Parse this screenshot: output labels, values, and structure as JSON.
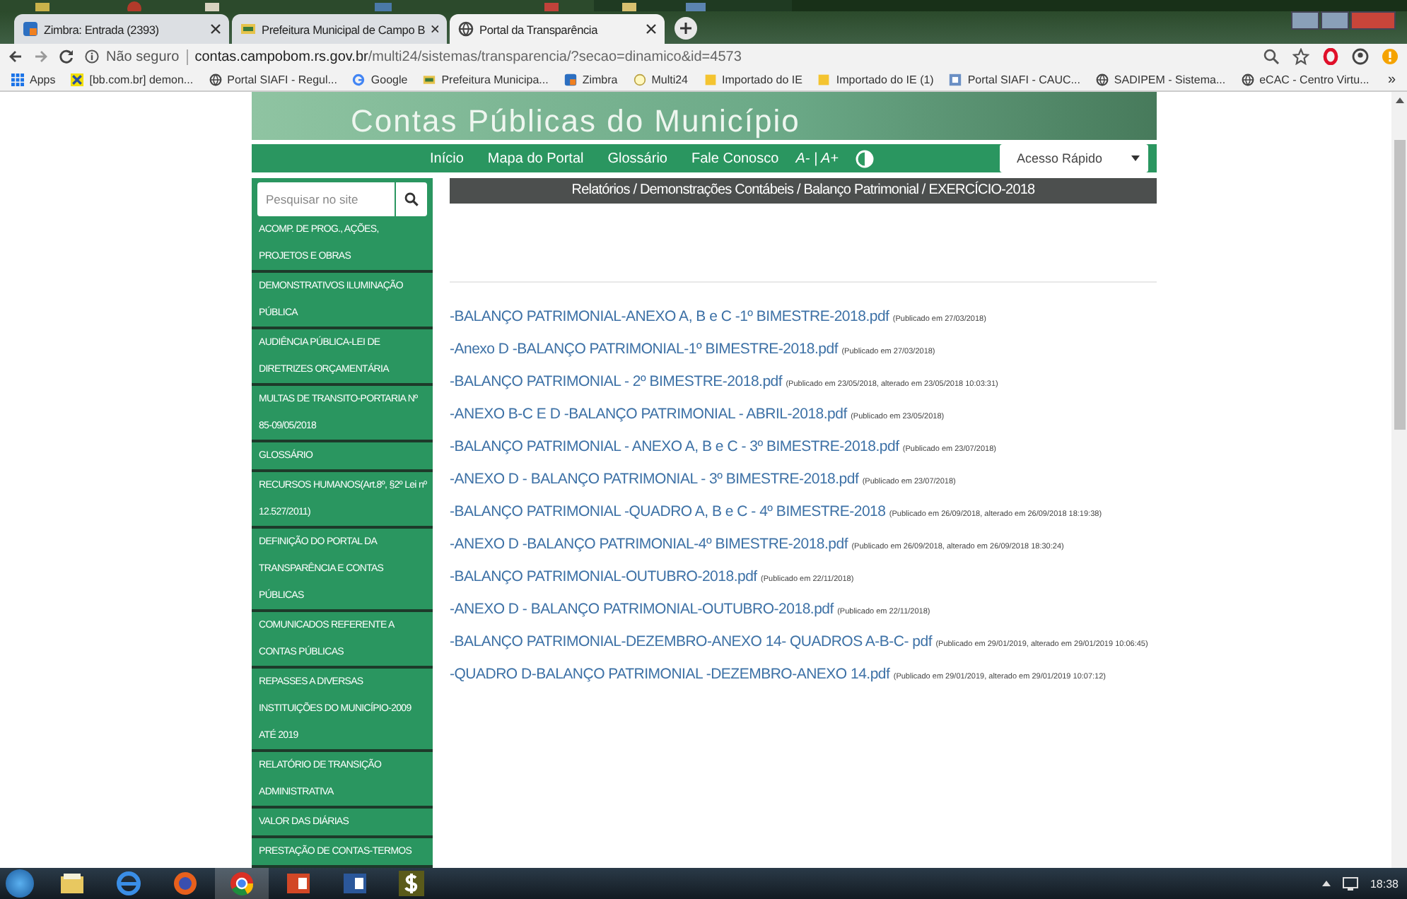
{
  "browser": {
    "tabs": [
      {
        "title": "Zimbra: Entrada (2393)",
        "selected": false
      },
      {
        "title": "Prefeitura Municipal de Campo B",
        "selected": false
      },
      {
        "title": "Portal da Transparência",
        "selected": true
      }
    ],
    "security": "Não seguro",
    "url_host": "contas.campobom.rs.gov.br",
    "url_path": "/multi24/sistemas/transparencia/?secao=dinamico&id=4573",
    "bookmarks": [
      "Apps",
      "[bb.com.br] demon...",
      "Portal SIAFI - Regul...",
      "Google",
      "Prefeitura Municipa...",
      "Zimbra",
      "Multi24",
      "Importado do IE",
      "Importado do IE (1)",
      "Portal SIAFI - CAUC...",
      "SADIPEM - Sistema...",
      "eCAC - Centro Virtu..."
    ],
    "more": "»"
  },
  "site": {
    "banner_title": "Contas Públicas do Município",
    "nav": [
      "Início",
      "Mapa do Portal",
      "Glossário",
      "Fale Conosco"
    ],
    "font_controls": "A- | A+",
    "quick_access": "Acesso Rápido",
    "search_placeholder": "Pesquisar no site",
    "sidebar": [
      "ACOMP. DE PROG., AÇÕES, PROJETOS E OBRAS",
      "DEMONSTRATIVOS ILUMINAÇÃO PÚBLICA",
      "AUDIÊNCIA PÚBLICA-LEI DE DIRETRIZES ORÇAMENTÁRIA",
      "MULTAS DE TRANSITO-PORTARIA Nº 85-09/05/2018",
      "GLOSSÁRIO",
      "RECURSOS HUMANOS(Art.8º, §2º Lei nº 12.527/2011)",
      "DEFINIÇÃO DO PORTAL DA TRANSPARÊNCIA E CONTAS PÚBLICAS",
      "COMUNICADOS REFERENTE A CONTAS PÚBLICAS",
      "REPASSES A DIVERSAS INSTITUIÇÕES DO MUNICÍPIO-2009 ATÉ 2019",
      "RELATÓRIO DE TRANSIÇÃO ADMINISTRATIVA",
      "VALOR DAS DIÁRIAS",
      "PRESTAÇÃO DE CONTAS-TERMOS"
    ],
    "breadcrumb": "Relatórios / Demonstrações Contábeis / Balanço Patrimonial / EXERCÍCIO-2018",
    "documents": [
      {
        "title": "-BALANÇO PATRIMONIAL-ANEXO A, B e C -1º BIMESTRE-2018.pdf",
        "note": "(Publicado em 27/03/2018)"
      },
      {
        "title": "-Anexo D -BALANÇO PATRIMONIAL-1º BIMESTRE-2018.pdf",
        "note": "(Publicado em 27/03/2018)"
      },
      {
        "title": "-BALANÇO PATRIMONIAL - 2º BIMESTRE-2018.pdf",
        "note": "(Publicado em 23/05/2018, alterado em 23/05/2018 10:03:31)"
      },
      {
        "title": "-ANEXO B-C E D -BALANÇO PATRIMONIAL - ABRIL-2018.pdf",
        "note": "(Publicado em 23/05/2018)"
      },
      {
        "title": "-BALANÇO PATRIMONIAL - ANEXO A, B e C - 3º BIMESTRE-2018.pdf",
        "note": "(Publicado em 23/07/2018)"
      },
      {
        "title": "-ANEXO D - BALANÇO PATRIMONIAL - 3º BIMESTRE-2018.pdf",
        "note": "(Publicado em 23/07/2018)"
      },
      {
        "title": "-BALANÇO PATRIMONIAL -QUADRO A, B e C - 4º BIMESTRE-2018",
        "note": "(Publicado em 26/09/2018, alterado em 26/09/2018 18:19:38)"
      },
      {
        "title": "-ANEXO D -BALANÇO PATRIMONIAL-4º BIMESTRE-2018.pdf",
        "note": "(Publicado em 26/09/2018, alterado em 26/09/2018 18:30:24)"
      },
      {
        "title": "-BALANÇO PATRIMONIAL-OUTUBRO-2018.pdf",
        "note": "(Publicado em 22/11/2018)"
      },
      {
        "title": "-ANEXO D - BALANÇO PATRIMONIAL-OUTUBRO-2018.pdf",
        "note": "(Publicado em 22/11/2018)"
      },
      {
        "title": "-BALANÇO PATRIMONIAL-DEZEMBRO-ANEXO 14- QUADROS A-B-C- pdf",
        "note": "(Publicado em 29/01/2019, alterado em 29/01/2019 10:06:45)"
      },
      {
        "title": "-QUADRO D-BALANÇO PATRIMONIAL -DEZEMBRO-ANEXO 14.pdf",
        "note": "(Publicado em 29/01/2019, alterado em 29/01/2019 10:07:12)"
      }
    ]
  },
  "taskbar": {
    "apps": [
      {
        "active": false
      },
      {
        "active": false
      },
      {
        "active": false
      },
      {
        "active": true
      },
      {
        "active": false
      },
      {
        "active": false
      },
      {
        "active": false
      }
    ],
    "time": "18:38"
  }
}
